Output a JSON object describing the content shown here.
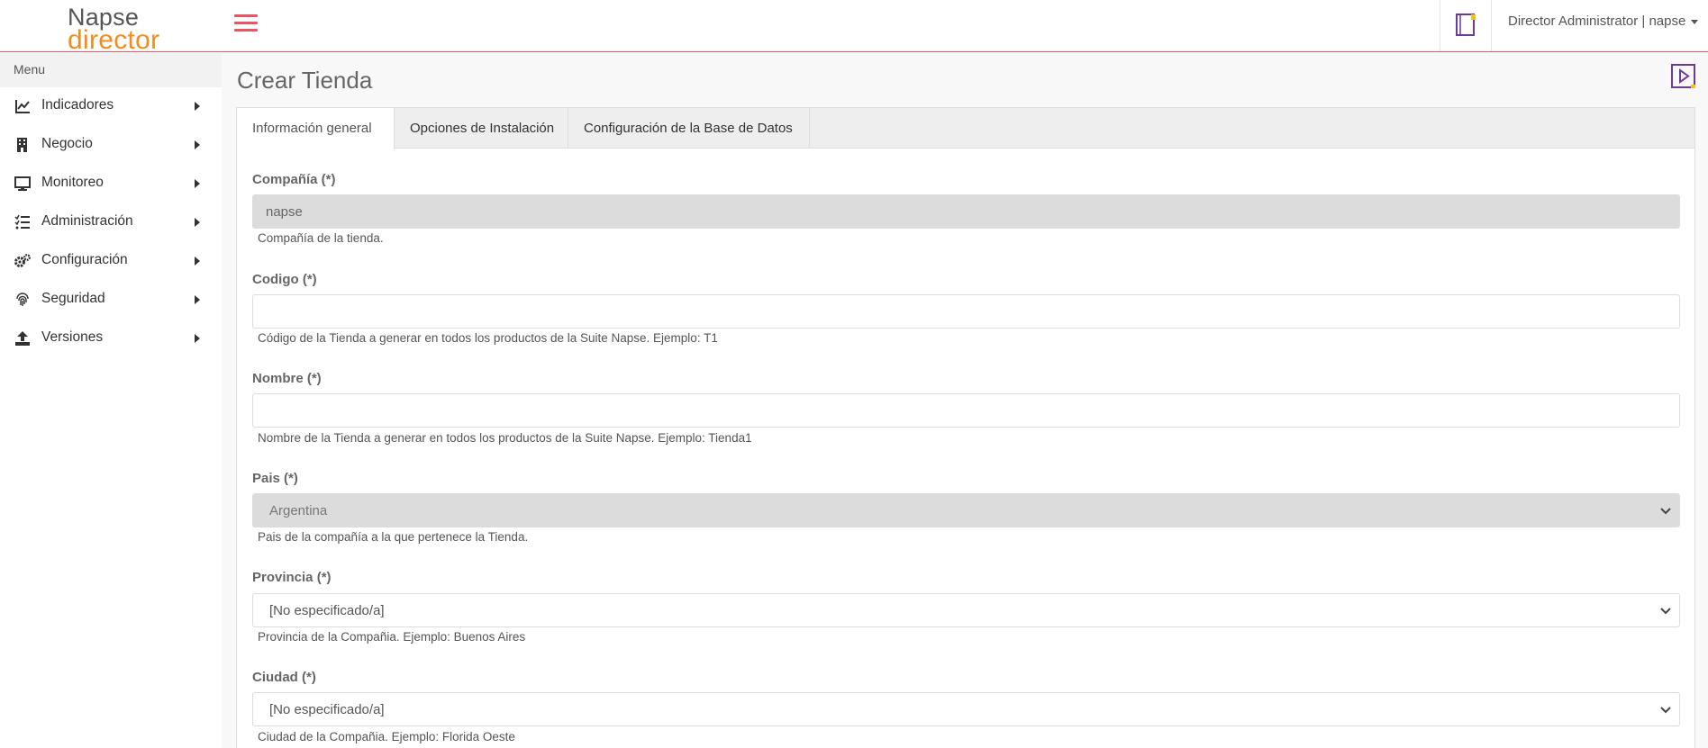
{
  "header": {
    "logo_line1": "Napse",
    "logo_line2": "director",
    "user_label": "Director Administrator | napse"
  },
  "sidebar": {
    "heading": "Menu",
    "items": [
      {
        "label": "Indicadores",
        "icon": "chart-line-icon"
      },
      {
        "label": "Negocio",
        "icon": "building-icon"
      },
      {
        "label": "Monitoreo",
        "icon": "monitor-icon"
      },
      {
        "label": "Administración",
        "icon": "list-check-icon"
      },
      {
        "label": "Configuración",
        "icon": "gears-icon"
      },
      {
        "label": "Seguridad",
        "icon": "fingerprint-icon"
      },
      {
        "label": "Versiones",
        "icon": "upload-icon"
      }
    ]
  },
  "main": {
    "title": "Crear Tienda",
    "tabs": [
      {
        "label": "Información general",
        "active": true
      },
      {
        "label": "Opciones de Instalación",
        "active": false
      },
      {
        "label": "Configuración de la Base de Datos",
        "active": false
      }
    ],
    "fields": {
      "compania": {
        "label": "Compañía (*)",
        "value": "napse",
        "help": "Compañía de la tienda."
      },
      "codigo": {
        "label": "Codigo (*)",
        "value": "",
        "help": "Código de la Tienda a generar en todos los productos de la Suite Napse. Ejemplo: T1"
      },
      "nombre": {
        "label": "Nombre (*)",
        "value": "",
        "help": "Nombre de la Tienda a generar en todos los productos de la Suite Napse. Ejemplo: Tienda1"
      },
      "pais": {
        "label": "Pais (*)",
        "value": "Argentina",
        "help": "Pais de la compañía a la que pertenece la Tienda."
      },
      "provincia": {
        "label": "Provincia (*)",
        "value": "[No especificado/a]",
        "help": "Provincia de la Compañia. Ejemplo: Buenos Aires"
      },
      "ciudad": {
        "label": "Ciudad (*)",
        "value": "[No especificado/a]",
        "help": "Ciudad de la Compañia. Ejemplo: Florida Oeste"
      }
    }
  },
  "colors": {
    "accent": "#e8545f",
    "logo_orange": "#f28c1e",
    "icon_purple": "#6b3a9a"
  }
}
